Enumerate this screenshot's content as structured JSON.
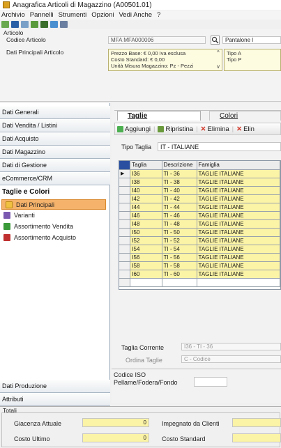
{
  "window": {
    "title": "Anagrafica Articoli di Magazzino (A00501.01)"
  },
  "menu": [
    "Archivio",
    "Pannelli",
    "Strumenti",
    "Opzioni",
    "Vedi Anche",
    "?"
  ],
  "toolbar_icons": [
    "new-doc-icon",
    "save-icon",
    "delete-icon",
    "tag-icon",
    "binoculars-icon",
    "print-icon",
    "filter-icon"
  ],
  "header": {
    "group_label": "Articolo",
    "code_label": "Codice Articolo",
    "code_value": "MFA  MFA000006",
    "desc_value": "Pantalone l",
    "principal_label": "Dati Principali Articolo",
    "info_lines": [
      "Prezzo Base: € 0,00 Iva esclusa",
      "Costo Standard: € 0,00",
      "Unità Misura Magazzino: Pz - Pezzi"
    ],
    "info2_lines": [
      "Tipo A",
      "Tipo P"
    ]
  },
  "sidebar": {
    "top_items": [
      "Dati Generali",
      "Dati Vendita / Listini",
      "Dati Acquisto",
      "Dati Magazzino",
      "Dati di Gestione",
      "eCommerce/CRM"
    ],
    "section": "Taglie e Colori",
    "sub_items": [
      "Dati Principali",
      "Varianti",
      "Assortimento Vendita",
      "Assortimento Acquisto"
    ],
    "bottom_items": [
      "Dati Produzione",
      "Attributi"
    ]
  },
  "main": {
    "tabs": [
      "Taglie",
      "Colori"
    ],
    "actions": [
      "Aggiungi",
      "Ripristina",
      "Elimina",
      "Elin"
    ],
    "tipo_label": "Tipo Taglia",
    "tipo_value": "IT - ITALIANE",
    "columns": [
      "Taglia",
      "Descrizione",
      "Famiglia"
    ],
    "rows": [
      [
        "I36",
        "TI - 36",
        "TAGLIE ITALIANE"
      ],
      [
        "I38",
        "TI - 38",
        "TAGLIE ITALIANE"
      ],
      [
        "I40",
        "TI - 40",
        "TAGLIE ITALIANE"
      ],
      [
        "I42",
        "TI - 42",
        "TAGLIE ITALIANE"
      ],
      [
        "I44",
        "TI - 44",
        "TAGLIE ITALIANE"
      ],
      [
        "I46",
        "TI - 46",
        "TAGLIE ITALIANE"
      ],
      [
        "I48",
        "TI - 48",
        "TAGLIE ITALIANE"
      ],
      [
        "I50",
        "TI - 50",
        "TAGLIE ITALIANE"
      ],
      [
        "I52",
        "TI - 52",
        "TAGLIE ITALIANE"
      ],
      [
        "I54",
        "TI - 54",
        "TAGLIE ITALIANE"
      ],
      [
        "I56",
        "TI - 56",
        "TAGLIE ITALIANE"
      ],
      [
        "I58",
        "TI - 58",
        "TAGLIE ITALIANE"
      ],
      [
        "I60",
        "TI - 60",
        "TAGLIE ITALIANE"
      ]
    ],
    "taglia_corrente_label": "Taglia Corrente",
    "taglia_corrente_value": "I36 - TI - 36",
    "ordina_label": "Ordina Taglie",
    "ordina_value": "C - Codice",
    "iso_label_1": "Codice ISO",
    "iso_label_2": "Pellame/Fodera/Fondo",
    "iso_value": ""
  },
  "totals": {
    "group_label": "Totali",
    "giacenza_label": "Giacenza Attuale",
    "giacenza_value": "0",
    "impegnato_label": "Impegnato da Clienti",
    "costo_ultimo_label": "Costo Ultimo",
    "costo_ultimo_value": "0",
    "costo_std_label": "Costo Standard"
  },
  "colors": {
    "accent_yellow": "#fbf3a6",
    "selected_orange": "#f4b26a",
    "sidebar_border": "#a9b6c4"
  }
}
